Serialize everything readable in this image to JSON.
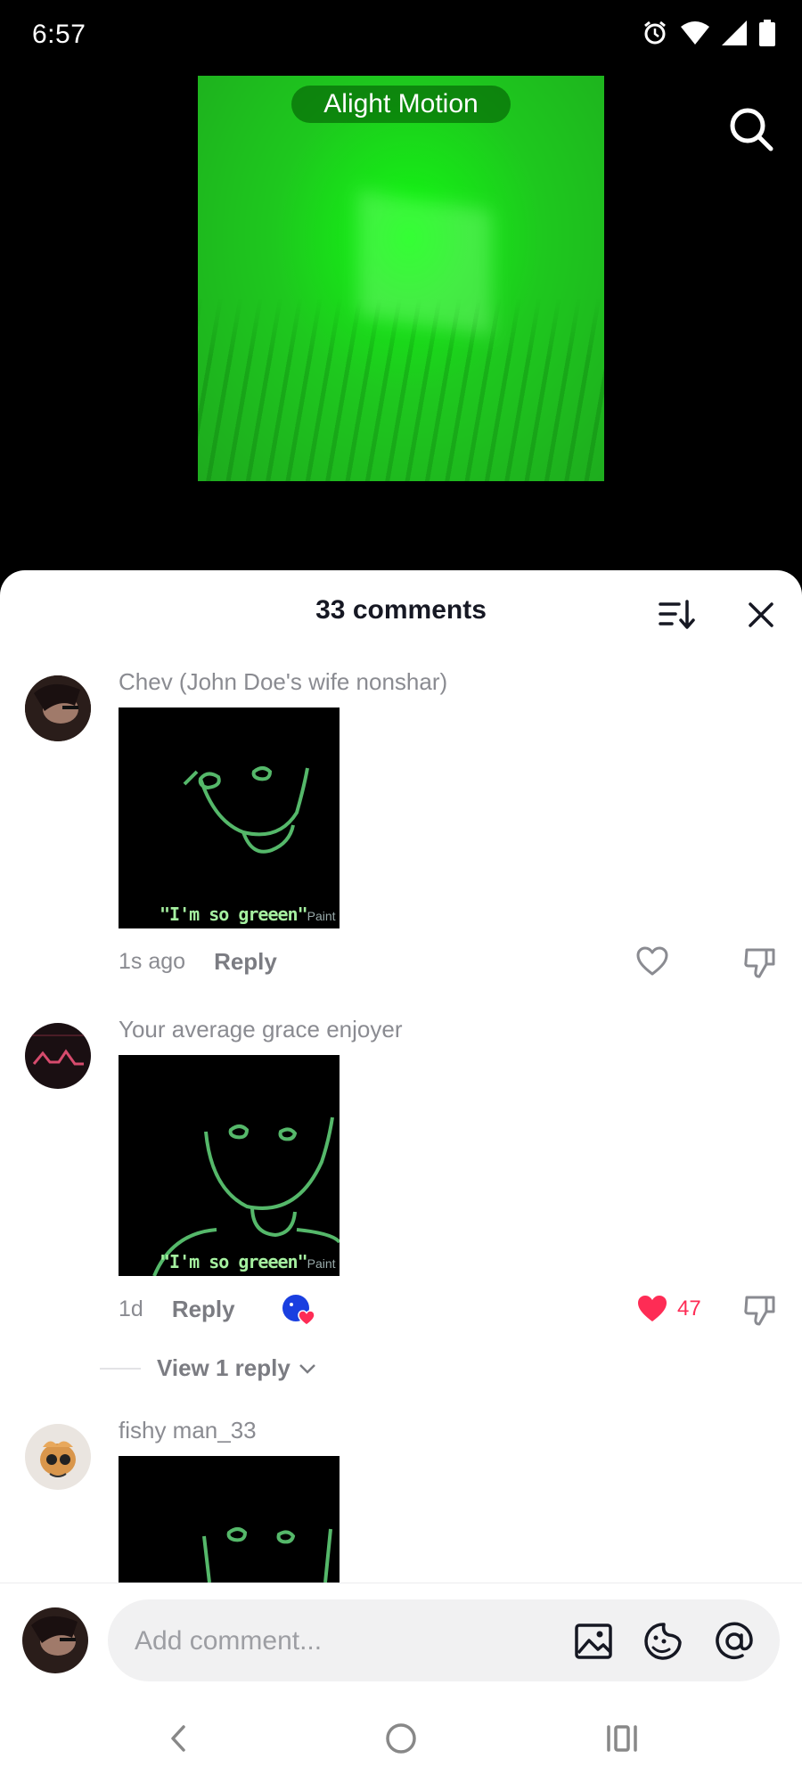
{
  "status": {
    "time": "6:57"
  },
  "video": {
    "watermark": "Alight Motion"
  },
  "sheet": {
    "title": "33 comments",
    "comments": [
      {
        "username": "Chev (John Doe's wife nonshar)",
        "sticker_caption": "\"I'm so greeen\"",
        "sticker_app": "Paint",
        "time": "1s ago",
        "reply_label": "Reply",
        "likes": ""
      },
      {
        "username": "Your average grace enjoyer",
        "sticker_caption": "\"I'm so greeen\"",
        "sticker_app": "Paint",
        "time": "1d",
        "reply_label": "Reply",
        "likes": "47",
        "view_replies": "View 1 reply"
      },
      {
        "username": "fishy man_33"
      }
    ]
  },
  "input": {
    "placeholder": "Add comment..."
  },
  "colors": {
    "accent": "#fe2c55",
    "text": "#161823",
    "muted": "#8a8b91",
    "video_green": "#00ff00"
  }
}
